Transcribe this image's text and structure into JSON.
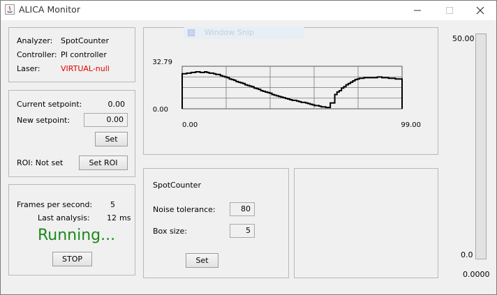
{
  "window": {
    "title": "ALICA Monitor",
    "minimize_icon": "minimize-icon",
    "maximize_icon": "maximize-icon",
    "close_icon": "close-icon"
  },
  "info": {
    "analyzer_label": "Analyzer:",
    "analyzer_value": "SpotCounter",
    "controller_label": "Controller:",
    "controller_value": "PI controller",
    "laser_label": "Laser:",
    "laser_value": "VIRTUAL-null",
    "laser_color": "#e00000"
  },
  "setpoint": {
    "current_label": "Current setpoint:",
    "current_value": "0.00",
    "new_label": "New setpoint:",
    "new_value": "0.00",
    "set_button": "Set",
    "roi_label": "ROI: Not set",
    "roi_button": "Set ROI"
  },
  "status": {
    "fps_label": "Frames per second:",
    "fps_value": "5",
    "analysis_label": "Last analysis:",
    "analysis_value": "12",
    "analysis_unit": "ms",
    "state": "Running...",
    "state_color": "#1a8a1a",
    "stop_button": "STOP"
  },
  "overlay": {
    "snip_label": "Window Snip"
  },
  "chart_data": {
    "type": "line",
    "title": "",
    "xlabel": "",
    "ylabel": "",
    "xlim": [
      0,
      99
    ],
    "ylim": [
      0,
      32.79
    ],
    "x_tick_labels": [
      "0.00",
      "99.00"
    ],
    "y_tick_labels": [
      "32.79",
      "0.00"
    ],
    "grid": true,
    "series": [
      {
        "values": [
          27,
          27,
          27.5,
          27.5,
          28,
          28,
          28.5,
          28.5,
          28,
          28,
          28.5,
          28,
          27.5,
          27.5,
          27,
          26.5,
          26.5,
          25.5,
          25,
          24.5,
          24,
          23,
          22.5,
          22,
          21,
          20.5,
          20,
          19.5,
          18.5,
          18,
          17.5,
          17,
          16,
          15.5,
          15,
          14,
          13.5,
          13,
          12.5,
          12,
          11,
          10.5,
          10,
          9.5,
          9,
          8.5,
          8,
          7.5,
          7,
          6.5,
          6.5,
          6,
          5.5,
          5,
          5,
          4.5,
          4,
          3.5,
          3,
          2.5,
          2.5,
          2,
          1.5,
          1.5,
          1,
          1,
          4.5,
          4.5,
          11,
          13,
          14,
          16,
          17,
          18.5,
          19.5,
          20.5,
          21.5,
          22.5,
          23,
          23.5,
          23.5,
          24,
          24,
          24,
          24,
          24,
          24,
          24.5,
          24.5,
          24,
          24,
          24,
          23.5,
          23.5,
          23.5,
          23,
          23,
          23,
          23
        ]
      }
    ]
  },
  "spot": {
    "title": "SpotCounter",
    "noise_label": "Noise tolerance:",
    "noise_value": "80",
    "box_label": "Box size:",
    "box_value": "5",
    "set_button": "Set"
  },
  "meter": {
    "max_label": "50.00",
    "min_label": "0.0",
    "value": 0.0,
    "value_label": "0.0000",
    "fill_color": "#3b7ddd"
  }
}
